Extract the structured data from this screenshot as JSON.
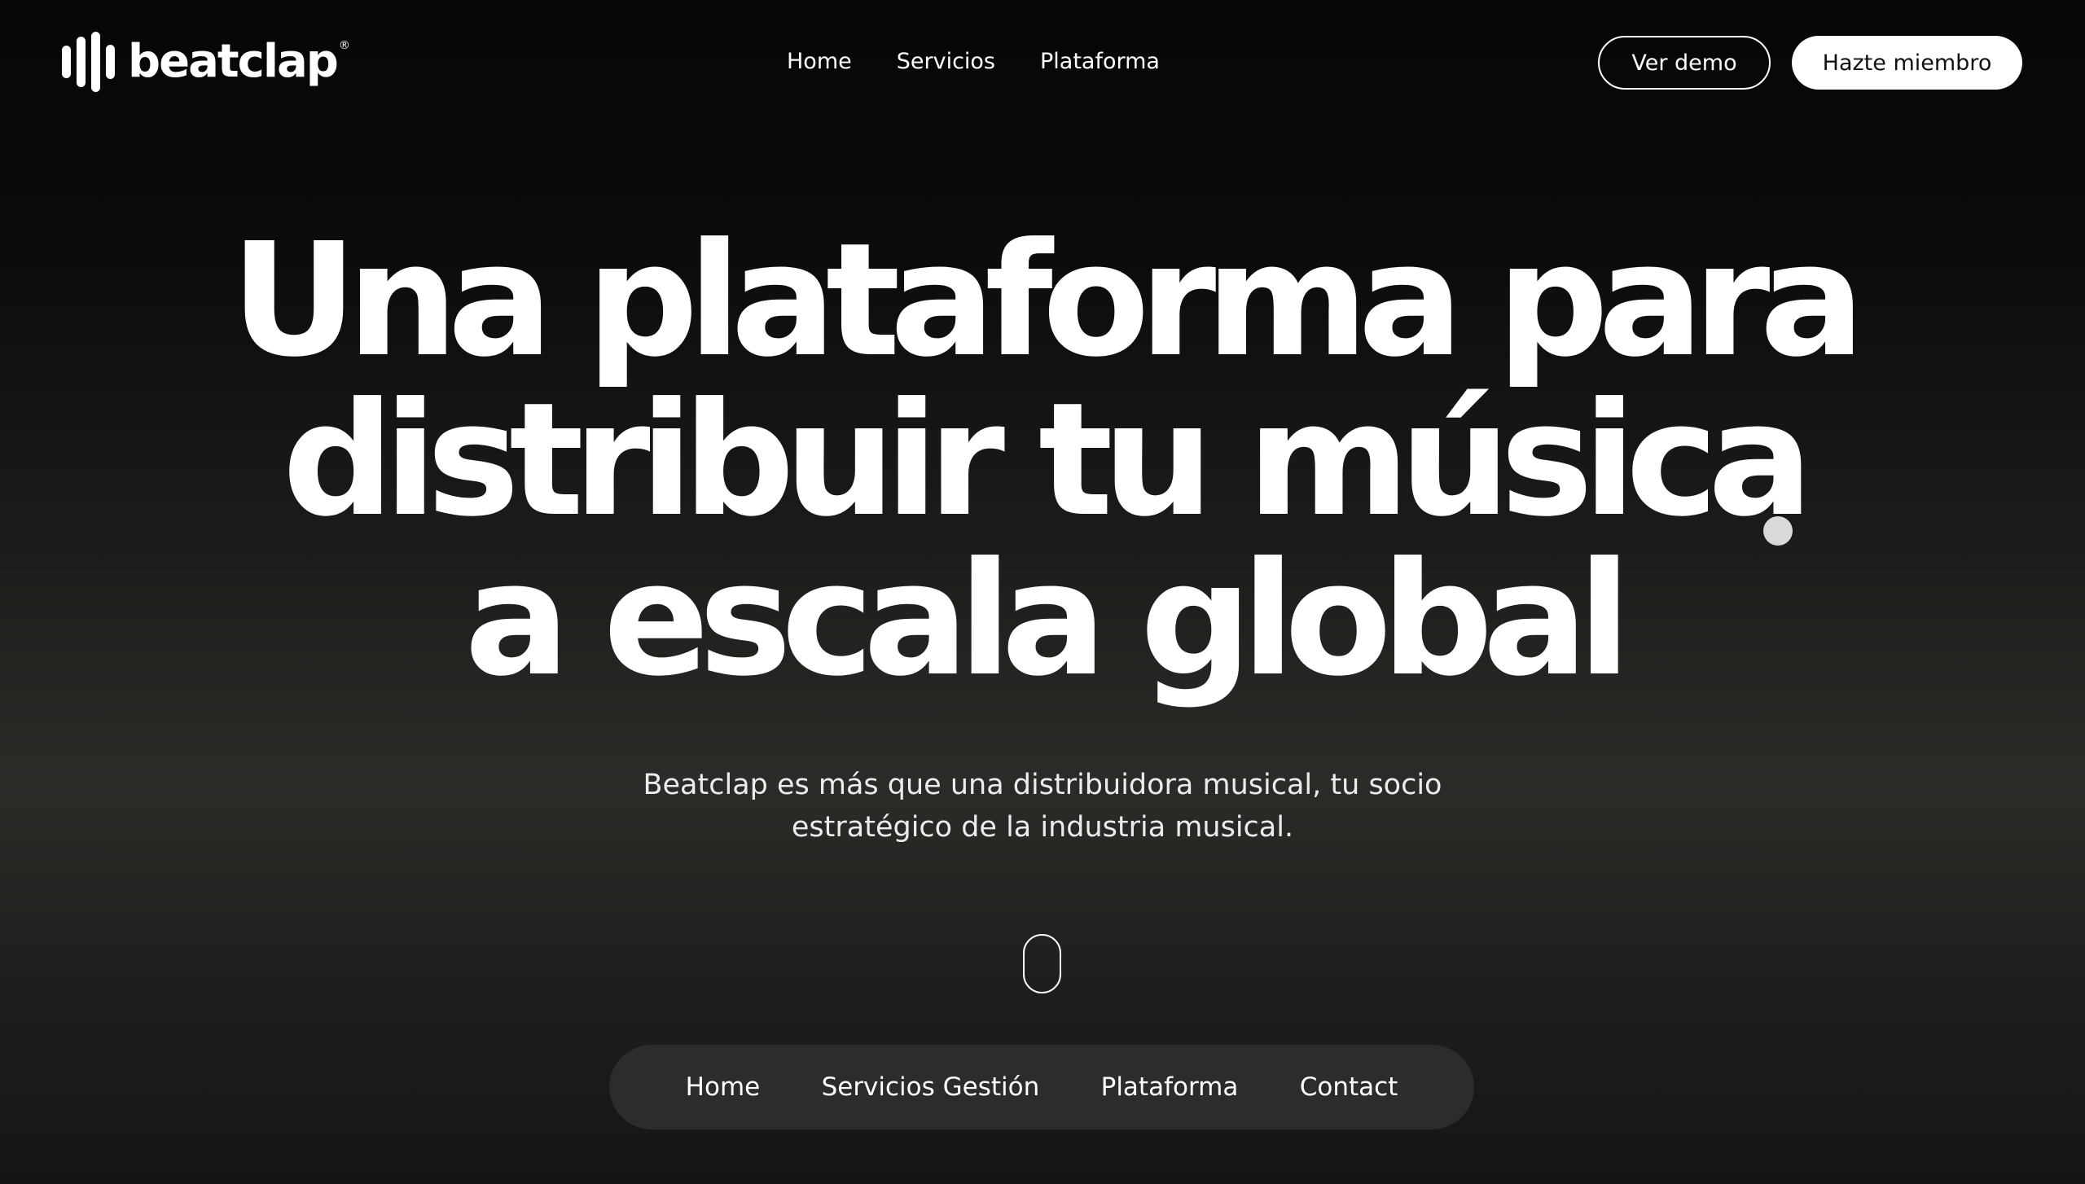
{
  "brand": {
    "name": "beatclap",
    "registered_mark": "®"
  },
  "header": {
    "nav": [
      {
        "label": "Home"
      },
      {
        "label": "Servicios"
      },
      {
        "label": "Plataforma"
      }
    ],
    "demo_button": "Ver demo",
    "member_button": "Hazte miembro"
  },
  "hero": {
    "title_lines": [
      "Una plataforma para",
      "distribuir tu música",
      "a escala global"
    ],
    "subtitle_lines": [
      "Beatclap es más que una distribuidora musical, tu socio",
      "estratégico de la industria musical."
    ]
  },
  "bottom_nav": [
    {
      "label": "Home"
    },
    {
      "label": "Servicios Gestión"
    },
    {
      "label": "Plataforma"
    },
    {
      "label": "Contact"
    }
  ],
  "icons": {
    "logo": "soundwave-bars-icon",
    "scroll": "mouse-scroll-icon"
  },
  "colors": {
    "background_dark": "#060606",
    "background_mid": "#2b2b28",
    "text": "#ffffff",
    "pill_bg": "#2c2c2b",
    "cursor_dot": "#d9d9d9"
  }
}
